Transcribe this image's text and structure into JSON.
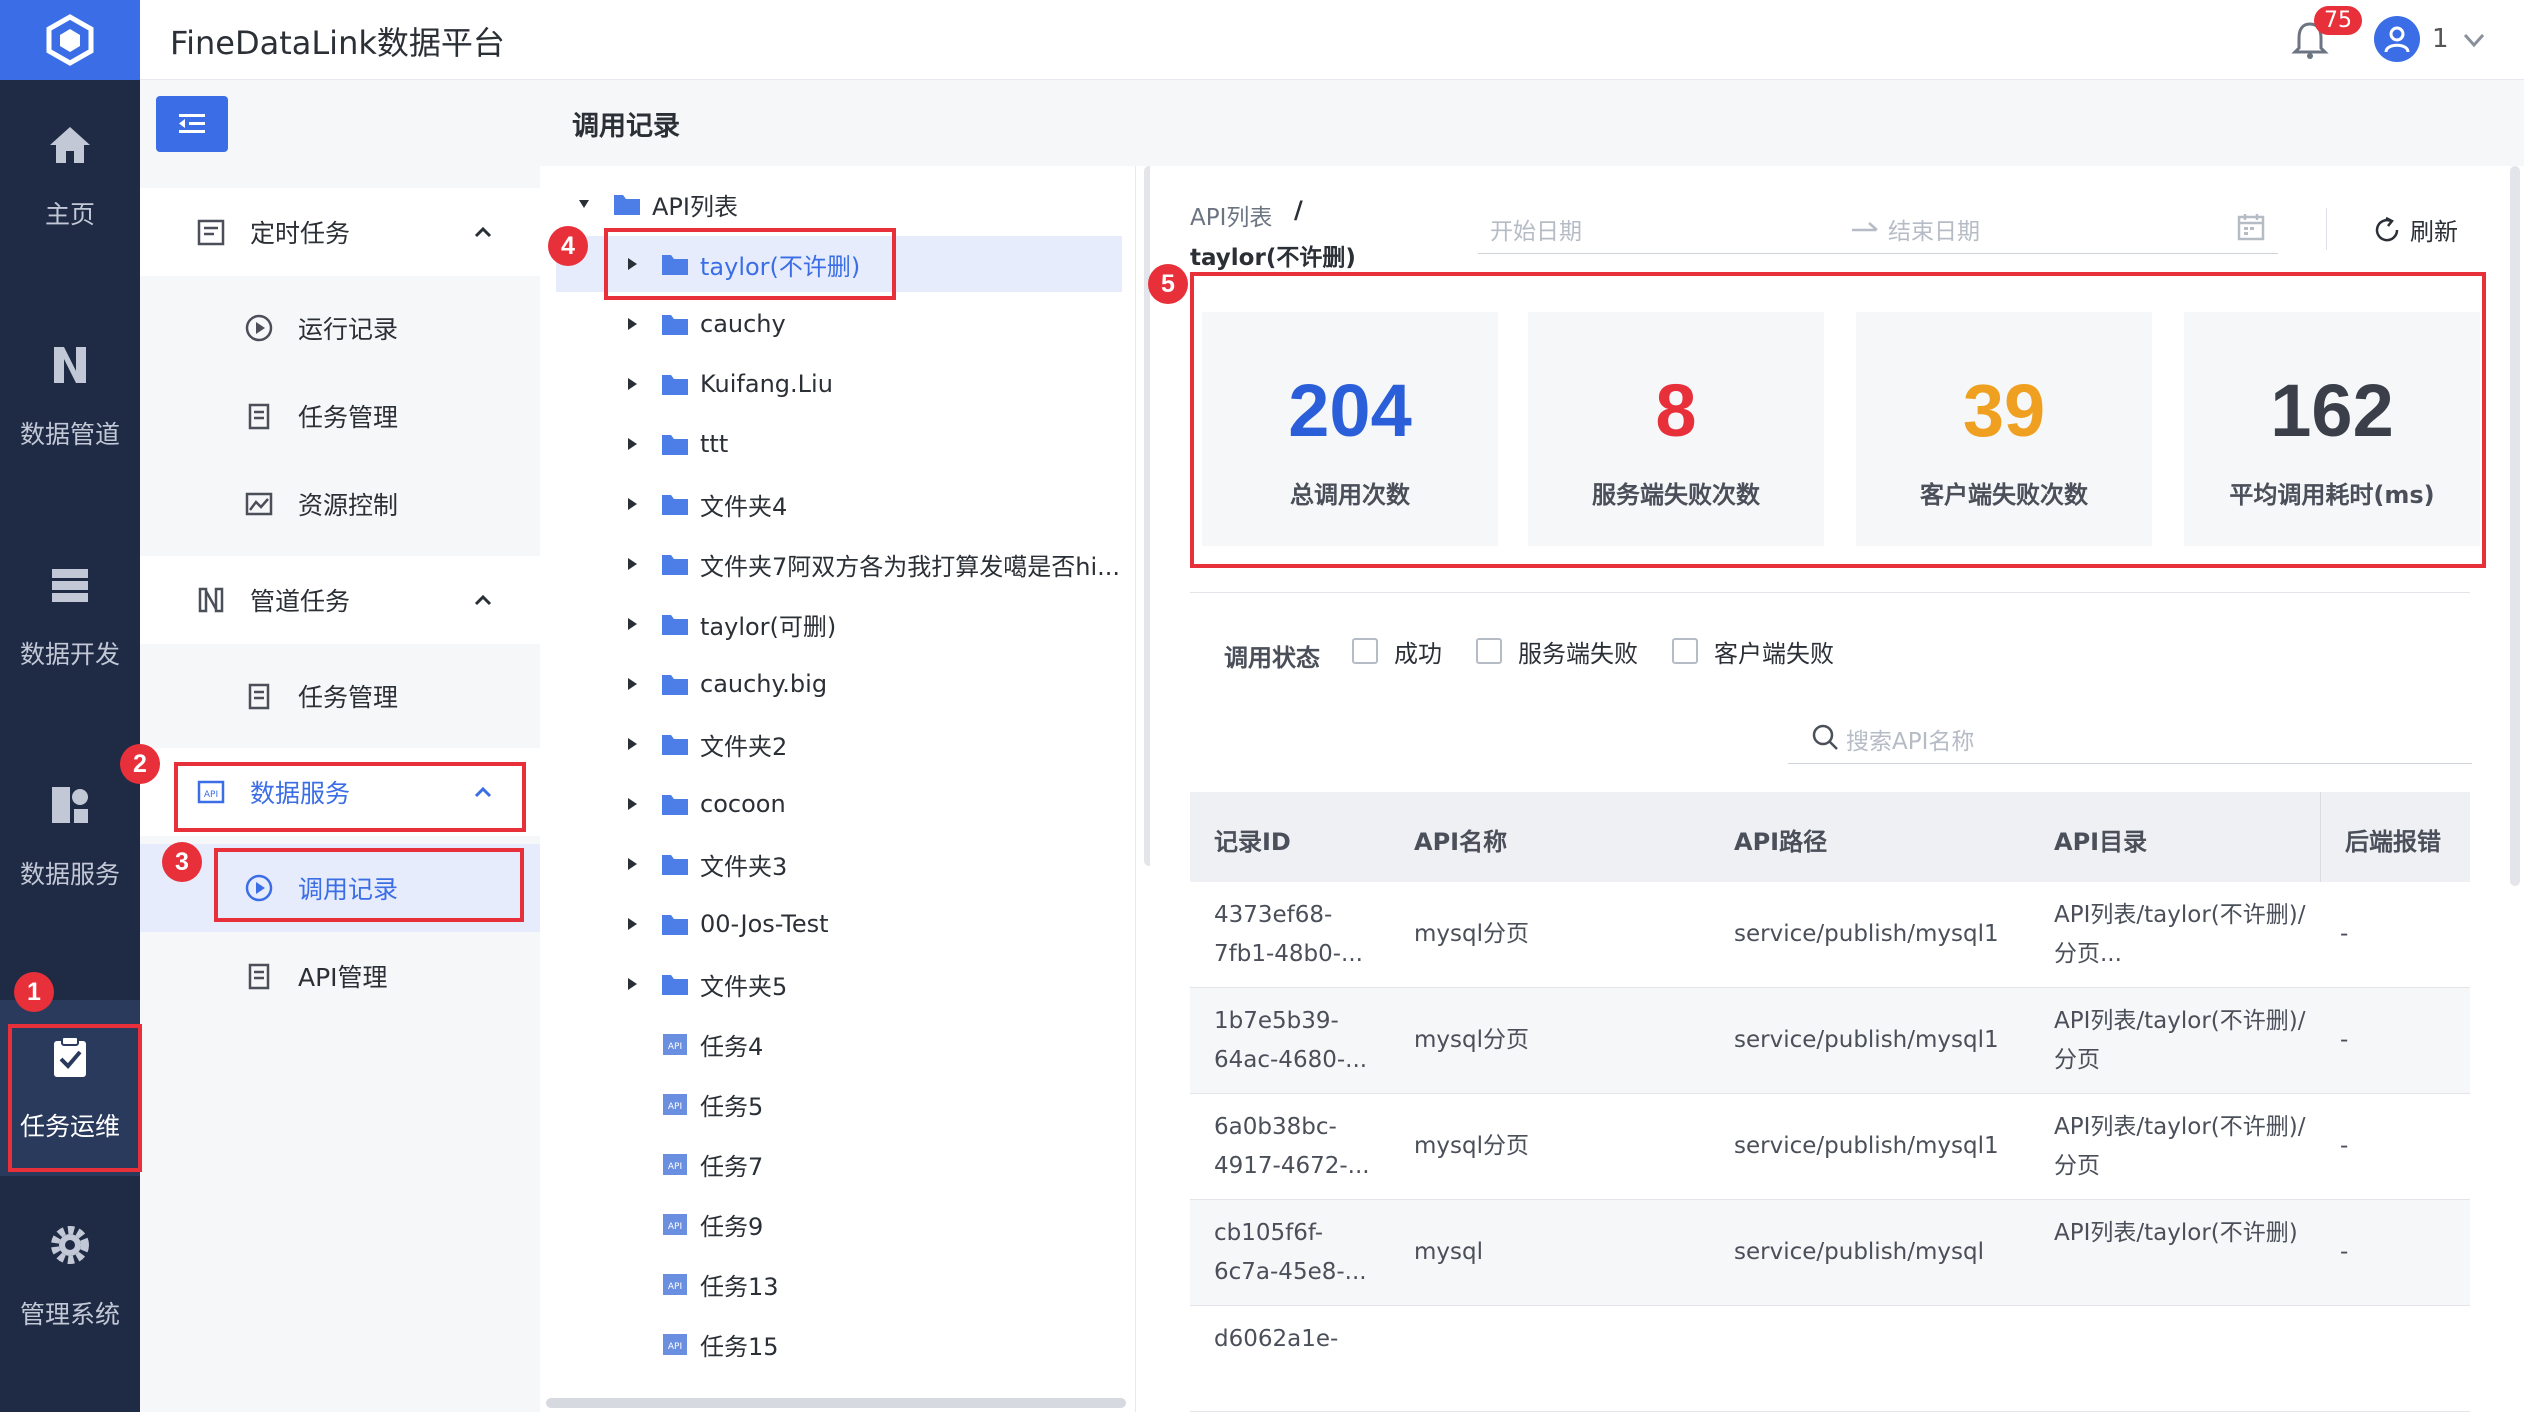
{
  "app": {
    "title": "FineDataLink数据平台",
    "notification_count": "75",
    "user_name": "1"
  },
  "rail": {
    "items": [
      {
        "label": "主页",
        "icon": "home-icon"
      },
      {
        "label": "数据管道",
        "icon": "pipeline-icon"
      },
      {
        "label": "数据开发",
        "icon": "dev-icon"
      },
      {
        "label": "数据服务",
        "icon": "service-icon"
      },
      {
        "label": "任务运维",
        "icon": "clipboard-check-icon",
        "active": true
      },
      {
        "label": "管理系统",
        "icon": "gear-icon"
      }
    ]
  },
  "nav": {
    "groups": [
      {
        "label": "定时任务",
        "children": [
          "运行记录",
          "任务管理",
          "资源控制"
        ]
      },
      {
        "label": "管道任务",
        "children": [
          "任务管理"
        ]
      },
      {
        "label": "数据服务",
        "children": [
          "调用记录",
          "API管理"
        ],
        "active": true
      }
    ],
    "active_item": "调用记录"
  },
  "content": {
    "title": "调用记录"
  },
  "tree": {
    "root": "API列表",
    "folders": [
      "taylor(不许删)",
      "cauchy",
      "Kuifang.Liu",
      "ttt",
      "文件夹4",
      "文件夹7阿双方各为我打算发噶是否hi...",
      "taylor(可删)",
      "cauchy.big",
      "文件夹2",
      "cocoon",
      "文件夹3",
      "00-Jos-Test",
      "文件夹5"
    ],
    "apis": [
      "任务4",
      "任务5",
      "任务7",
      "任务9",
      "任务13",
      "任务15"
    ],
    "selected": "taylor(不许删)"
  },
  "detail": {
    "breadcrumb": [
      "API列表",
      "/",
      "taylor(不许删)"
    ],
    "date_start_placeholder": "开始日期",
    "date_end_placeholder": "结束日期",
    "refresh_label": "刷新",
    "stats": [
      {
        "value": "204",
        "label": "总调用次数",
        "color": "#2b5fd9"
      },
      {
        "value": "8",
        "label": "服务端失败次数",
        "color": "#e7303a"
      },
      {
        "value": "39",
        "label": "客户端失败次数",
        "color": "#f0a020"
      },
      {
        "value": "162",
        "label": "平均调用耗时(ms)",
        "color": "#3a3f4a"
      }
    ],
    "filter": {
      "label": "调用状态",
      "options": [
        "成功",
        "服务端失败",
        "客户端失败"
      ]
    },
    "search_placeholder": "搜索API名称",
    "table": {
      "columns": [
        "记录ID",
        "API名称",
        "API路径",
        "API目录",
        "后端报错"
      ],
      "rows": [
        {
          "id": [
            "4373ef68-",
            "7fb1-48b0-..."
          ],
          "name": "mysql分页",
          "path": "service/publish/mysql1",
          "dir": [
            "API列表/taylor(不许删)/",
            "分页..."
          ],
          "err": "-"
        },
        {
          "id": [
            "1b7e5b39-",
            "64ac-4680-..."
          ],
          "name": "mysql分页",
          "path": "service/publish/mysql1",
          "dir": [
            "API列表/taylor(不许删)/",
            "分页"
          ],
          "err": "-"
        },
        {
          "id": [
            "6a0b38bc-",
            "4917-4672-..."
          ],
          "name": "mysql分页",
          "path": "service/publish/mysql1",
          "dir": [
            "API列表/taylor(不许删)/",
            "分页"
          ],
          "err": "-"
        },
        {
          "id": [
            "cb105f6f-",
            "6c7a-45e8-..."
          ],
          "name": "mysql",
          "path": "service/publish/mysql",
          "dir": [
            "API列表/taylor(不许删)",
            ""
          ],
          "err": "-"
        },
        {
          "id": [
            "d6062a1e-",
            ""
          ],
          "name": "",
          "path": "",
          "dir": [
            "",
            ""
          ],
          "err": ""
        }
      ]
    }
  },
  "annotations": [
    "1",
    "2",
    "3",
    "4",
    "5"
  ]
}
